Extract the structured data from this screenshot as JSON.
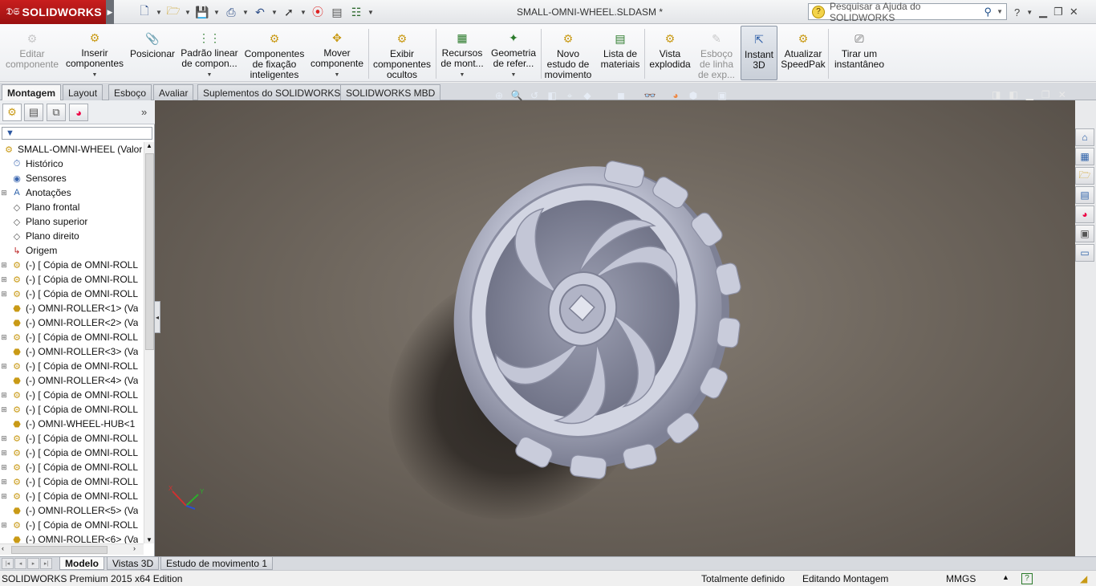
{
  "app": {
    "brand": "SOLIDWORKS",
    "document_title": "SMALL-OMNI-WHEEL.SLDASM *"
  },
  "search": {
    "placeholder": "Pesquisar a Ajuda do SOLIDWORKS"
  },
  "ribbon": {
    "buttons": [
      {
        "label1": "Editar",
        "label2": "componente",
        "enabled": false
      },
      {
        "label1": "Inserir",
        "label2": "componentes"
      },
      {
        "label1": "Posicionar",
        "label2": ""
      },
      {
        "label1": "Padrão linear",
        "label2": "de compon..."
      },
      {
        "label1": "Componentes",
        "label2": "de fixação",
        "label3": "inteligentes"
      },
      {
        "label1": "Mover",
        "label2": "componente"
      },
      {
        "label1": "Exibir",
        "label2": "componentes",
        "label3": "ocultos"
      },
      {
        "label1": "Recursos",
        "label2": "de mont..."
      },
      {
        "label1": "Geometria",
        "label2": "de refer..."
      },
      {
        "label1": "Novo",
        "label2": "estudo de",
        "label3": "movimento"
      },
      {
        "label1": "Lista de",
        "label2": "materiais"
      },
      {
        "label1": "Vista",
        "label2": "explodida"
      },
      {
        "label1": "Esboço",
        "label2": "de linha",
        "label3": "de exp...",
        "enabled": false
      },
      {
        "label1": "Instant",
        "label2": "3D",
        "active": true
      },
      {
        "label1": "Atualizar",
        "label2": "SpeedPak"
      },
      {
        "label1": "Tirar um",
        "label2": "instantâneo"
      }
    ]
  },
  "command_tabs": [
    "Montagem",
    "Layout",
    "Esboço",
    "Avaliar",
    "Suplementos do SOLIDWORKS",
    "SOLIDWORKS MBD"
  ],
  "feature_tree": {
    "root": "SMALL-OMNI-WHEEL  (Valor",
    "items": [
      {
        "label": "Histórico",
        "icon": "history-icon"
      },
      {
        "label": "Sensores",
        "icon": "sensor-icon"
      },
      {
        "label": "Anotações",
        "icon": "annotation-icon"
      },
      {
        "label": "Plano frontal",
        "icon": "plane-icon"
      },
      {
        "label": "Plano superior",
        "icon": "plane-icon"
      },
      {
        "label": "Plano direito",
        "icon": "plane-icon"
      },
      {
        "label": "Origem",
        "icon": "origin-icon"
      },
      {
        "label": "(-) [ Cópia de OMNI-ROLL",
        "icon": "subassembly-icon"
      },
      {
        "label": "(-) [ Cópia de OMNI-ROLL",
        "icon": "subassembly-icon"
      },
      {
        "label": "(-) [ Cópia de OMNI-ROLL",
        "icon": "subassembly-icon"
      },
      {
        "label": "(-) OMNI-ROLLER<1> (Va",
        "icon": "part-icon"
      },
      {
        "label": "(-) OMNI-ROLLER<2> (Va",
        "icon": "part-icon"
      },
      {
        "label": "(-) [ Cópia de OMNI-ROLL",
        "icon": "subassembly-icon"
      },
      {
        "label": "(-) OMNI-ROLLER<3> (Va",
        "icon": "part-icon"
      },
      {
        "label": "(-) [ Cópia de OMNI-ROLL",
        "icon": "subassembly-icon"
      },
      {
        "label": "(-) OMNI-ROLLER<4> (Va",
        "icon": "part-icon"
      },
      {
        "label": "(-) [ Cópia de OMNI-ROLL",
        "icon": "subassembly-icon"
      },
      {
        "label": "(-) [ Cópia de OMNI-ROLL",
        "icon": "subassembly-icon"
      },
      {
        "label": "(-) OMNI-WHEEL-HUB<1",
        "icon": "part-icon"
      },
      {
        "label": "(-) [ Cópia de OMNI-ROLL",
        "icon": "subassembly-icon"
      },
      {
        "label": "(-) [ Cópia de OMNI-ROLL",
        "icon": "subassembly-icon"
      },
      {
        "label": "(-) [ Cópia de OMNI-ROLL",
        "icon": "subassembly-icon"
      },
      {
        "label": "(-) [ Cópia de OMNI-ROLL",
        "icon": "subassembly-icon"
      },
      {
        "label": "(-) [ Cópia de OMNI-ROLL",
        "icon": "subassembly-icon"
      },
      {
        "label": "(-) OMNI-ROLLER<5> (Va",
        "icon": "part-icon"
      },
      {
        "label": "(-) [ Cópia de OMNI-ROLL",
        "icon": "subassembly-icon"
      },
      {
        "label": "(-) OMNI-ROLLER<6> (Va",
        "icon": "part-icon"
      }
    ]
  },
  "bottom_tabs": [
    "Modelo",
    "Vistas 3D",
    "Estudo de movimento 1"
  ],
  "status": {
    "edition": "SOLIDWORKS Premium 2015 x64 Edition",
    "definition": "Totalmente definido",
    "mode": "Editando Montagem",
    "units": "MMGS"
  },
  "colors": {
    "brand_red": "#c81e1e",
    "viewport_bg": "#6f675e",
    "model": "#b9bccc"
  }
}
